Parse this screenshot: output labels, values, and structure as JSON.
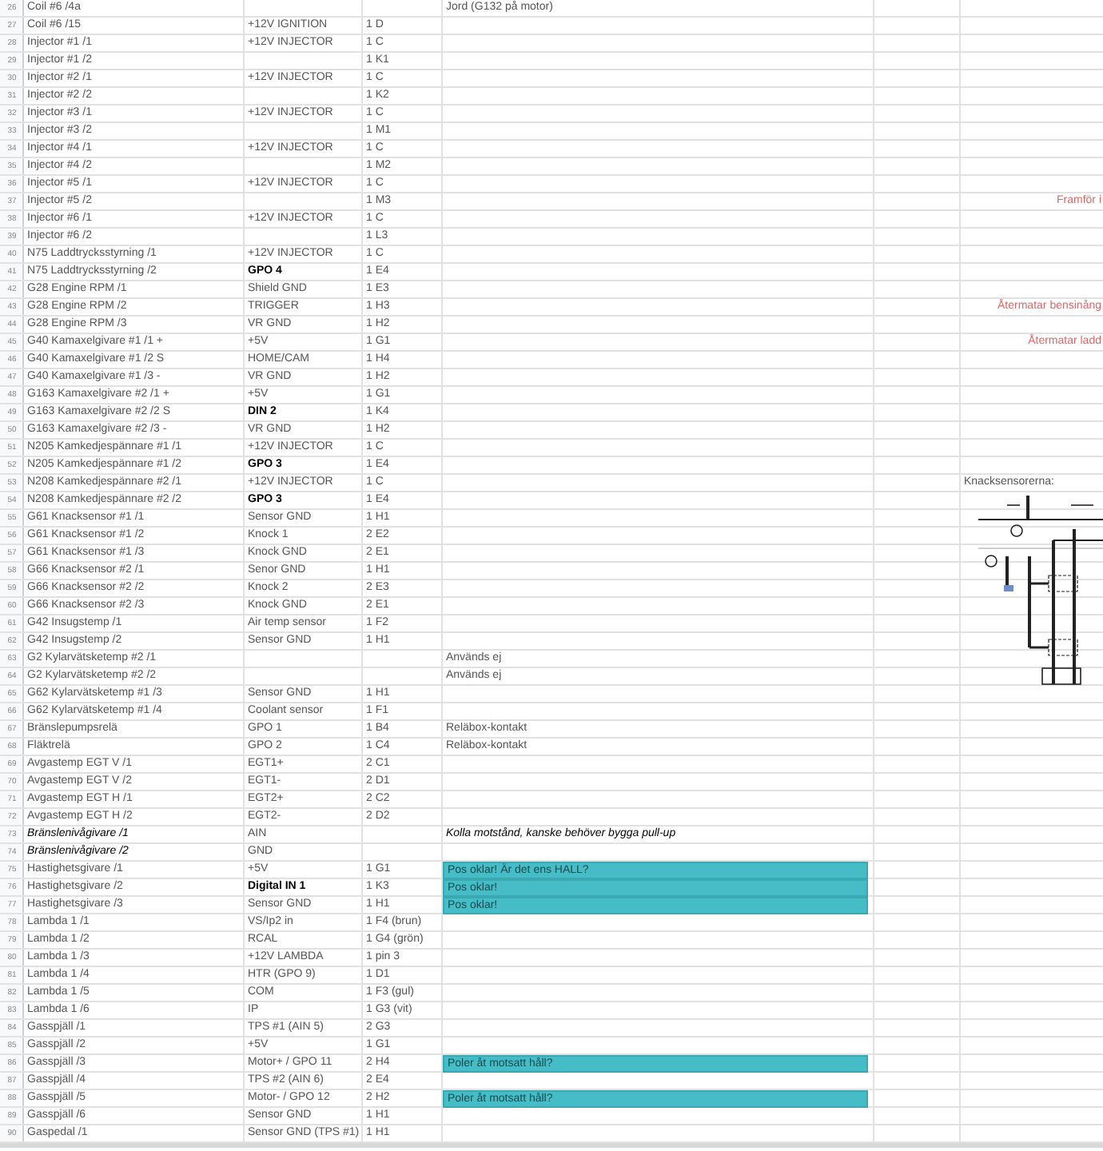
{
  "sheet": {
    "rows": [
      {
        "row": "26",
        "a": "Coil #6 /4a",
        "d": "Jord (G132 på motor)"
      },
      {
        "row": "27",
        "a": "Coil #6 /15",
        "b": "+12V IGNITION",
        "c": "1 D"
      },
      {
        "row": "28",
        "a": "Injector #1 /1",
        "b": "+12V INJECTOR",
        "c": "1 C"
      },
      {
        "row": "29",
        "a": "Injector #1 /2",
        "c": "1 K1"
      },
      {
        "row": "30",
        "a": "Injector #2 /1",
        "b": "+12V INJECTOR",
        "c": "1 C"
      },
      {
        "row": "31",
        "a": "Injector #2 /2",
        "c": "1 K2"
      },
      {
        "row": "32",
        "a": "Injector #3 /1",
        "b": "+12V INJECTOR",
        "c": "1 C"
      },
      {
        "row": "33",
        "a": "Injector #3 /2",
        "c": "1 M1"
      },
      {
        "row": "34",
        "a": "Injector #4 /1",
        "b": "+12V INJECTOR",
        "c": "1 C"
      },
      {
        "row": "35",
        "a": "Injector #4 /2",
        "c": "1 M2"
      },
      {
        "row": "36",
        "a": "Injector #5 /1",
        "b": "+12V INJECTOR",
        "c": "1 C"
      },
      {
        "row": "37",
        "a": "Injector #5 /2",
        "c": "1 M3",
        "f": "Framför i"
      },
      {
        "row": "38",
        "a": "Injector #6 /1",
        "b": "+12V INJECTOR",
        "c": "1 C"
      },
      {
        "row": "39",
        "a": "Injector #6 /2",
        "c": "1 L3"
      },
      {
        "row": "40",
        "a": "N75 Laddtrycksstyrning /1",
        "b": "+12V INJECTOR",
        "c": "1 C"
      },
      {
        "row": "41",
        "a": "N75 Laddtrycksstyrning /2",
        "b": "GPO 4",
        "b_bold": true,
        "c": "1 E4"
      },
      {
        "row": "42",
        "a": "G28 Engine RPM /1",
        "b": "Shield GND",
        "c": "1 E3"
      },
      {
        "row": "43",
        "a": "G28 Engine RPM /2",
        "b": "TRIGGER",
        "c": "1 H3",
        "f": "Återmatar bensinång"
      },
      {
        "row": "44",
        "a": "G28 Engine RPM /3",
        "b": "VR GND",
        "c": "1 H2"
      },
      {
        "row": "45",
        "a": "G40 Kamaxelgivare #1 /1 +",
        "b": "+5V",
        "c": "1 G1",
        "f": "Återmatar ladd"
      },
      {
        "row": "46",
        "a": "G40 Kamaxelgivare #1 /2 S",
        "b": "HOME/CAM",
        "c": "1 H4"
      },
      {
        "row": "47",
        "a": "G40 Kamaxelgivare #1 /3 -",
        "b": "VR GND",
        "c": "1 H2"
      },
      {
        "row": "48",
        "a": "G163 Kamaxelgivare #2 /1 +",
        "b": "+5V",
        "c": "1 G1"
      },
      {
        "row": "49",
        "a": "G163 Kamaxelgivare #2 /2 S",
        "b": "DIN 2",
        "b_bold": true,
        "c": "1 K4"
      },
      {
        "row": "50",
        "a": "G163 Kamaxelgivare #2 /3 -",
        "b": "VR GND",
        "c": "1 H2"
      },
      {
        "row": "51",
        "a": "N205 Kamkedjespännare #1 /1",
        "b": "+12V INJECTOR",
        "c": "1 C"
      },
      {
        "row": "52",
        "a": "N205 Kamkedjespännare #1 /2",
        "b": "GPO 3",
        "b_bold": true,
        "c": "1 E4"
      },
      {
        "row": "53",
        "a": "N208 Kamkedjespännare #2 /1",
        "b": "+12V INJECTOR",
        "c": "1 C",
        "f_label": "Knacksensorerna:"
      },
      {
        "row": "54",
        "a": "N208 Kamkedjespännare #2 /2",
        "b": "GPO 3",
        "b_bold": true,
        "c": "1 E4"
      },
      {
        "row": "55",
        "a": "G61 Knacksensor #1 /1",
        "b": "Sensor GND",
        "c": "1 H1"
      },
      {
        "row": "56",
        "a": "G61 Knacksensor #1 /2",
        "b": "Knock 1",
        "c": "2 E2"
      },
      {
        "row": "57",
        "a": "G61 Knacksensor #1 /3",
        "b": "Knock GND",
        "c": "2 E1"
      },
      {
        "row": "58",
        "a": "G66 Knacksensor #2 /1",
        "b": "Senor GND",
        "c": "1 H1"
      },
      {
        "row": "59",
        "a": "G66 Knacksensor #2 /2",
        "b": "Knock 2",
        "c": "2 E3"
      },
      {
        "row": "60",
        "a": "G66 Knacksensor #2 /3",
        "b": "Knock GND",
        "c": "2 E1"
      },
      {
        "row": "61",
        "a": "G42 Insugstemp /1",
        "b": "Air temp sensor",
        "c": "1 F2"
      },
      {
        "row": "62",
        "a": "G42 Insugstemp /2",
        "b": "Sensor GND",
        "c": "1 H1"
      },
      {
        "row": "63",
        "a": "G2 Kylarvätsketemp #2 /1",
        "d": "Används ej"
      },
      {
        "row": "64",
        "a": "G2 Kylarvätsketemp #2 /2",
        "d": "Används ej"
      },
      {
        "row": "65",
        "a": "G62 Kylarvätsketemp #1 /3",
        "b": "Sensor GND",
        "c": "1 H1"
      },
      {
        "row": "66",
        "a": "G62 Kylarvätsketemp #1 /4",
        "b": "Coolant sensor",
        "c": "1 F1"
      },
      {
        "row": "67",
        "a": "Bränslepumpsrelä",
        "b": "GPO 1",
        "c": "1 B4",
        "d": "Reläbox-kontakt"
      },
      {
        "row": "68",
        "a": "Fläktrelä",
        "b": "GPO 2",
        "c": "1 C4",
        "d": "Reläbox-kontakt"
      },
      {
        "row": "69",
        "a": "Avgastemp EGT V /1",
        "b": "EGT1+",
        "c": "2 C1"
      },
      {
        "row": "70",
        "a": "Avgastemp EGT V /2",
        "b": "EGT1-",
        "c": "2 D1"
      },
      {
        "row": "71",
        "a": "Avgastemp EGT H /1",
        "b": "EGT2+",
        "c": "2 C2"
      },
      {
        "row": "72",
        "a": "Avgastemp EGT H /2",
        "b": "EGT2-",
        "c": "2 D2"
      },
      {
        "row": "73",
        "a": "Bränslenivågivare /1",
        "italic": true,
        "b": "AIN",
        "d": "Kolla motstånd, kanske behöver bygga pull-up"
      },
      {
        "row": "74",
        "a": "Bränslenivågivare /2",
        "italic": true,
        "b": "GND"
      },
      {
        "row": "75",
        "a": "Hastighetsgivare /1",
        "b": "+5V",
        "c": "1 G1",
        "d": "Pos oklar! Är det ens HALL?",
        "highlight": true
      },
      {
        "row": "76",
        "a": "Hastighetsgivare /2",
        "b": "Digital IN 1",
        "b_bold": true,
        "c": "1 K3",
        "d": "Pos oklar!",
        "highlight": true
      },
      {
        "row": "77",
        "a": "Hastighetsgivare /3",
        "b": "Sensor GND",
        "c": "1 H1",
        "d": "Pos oklar!",
        "highlight": true
      },
      {
        "row": "78",
        "a": "Lambda 1 /1",
        "b": "VS/Ip2 in",
        "c": "1 F4 (brun)"
      },
      {
        "row": "79",
        "a": "Lambda 1 /2",
        "b": "RCAL",
        "c": "1 G4 (grön)"
      },
      {
        "row": "80",
        "a": "Lambda 1 /3",
        "b": "+12V LAMBDA",
        "c": "1 pin 3"
      },
      {
        "row": "81",
        "a": "Lambda 1 /4",
        "b": "HTR (GPO 9)",
        "c": "1 D1"
      },
      {
        "row": "82",
        "a": "Lambda 1 /5",
        "b": "COM",
        "c": "1 F3 (gul)"
      },
      {
        "row": "83",
        "a": "Lambda 1 /6",
        "b": "IP",
        "c": "1 G3 (vit)"
      },
      {
        "row": "84",
        "a": "Gasspjäll /1",
        "b": "TPS #1 (AIN 5)",
        "c": "2 G3"
      },
      {
        "row": "85",
        "a": "Gasspjäll /2",
        "b": "+5V",
        "c": "1 G1"
      },
      {
        "row": "86",
        "a": "Gasspjäll /3",
        "b": "Motor+ / GPO 11",
        "c": "2 H4",
        "d": "Poler åt motsatt håll?",
        "highlight": true
      },
      {
        "row": "87",
        "a": "Gasspjäll /4",
        "b": "TPS #2 (AIN 6)",
        "c": "2 E4"
      },
      {
        "row": "88",
        "a": "Gasspjäll /5",
        "b": "Motor- / GPO 12",
        "c": "2 H2",
        "d": "Poler åt motsatt håll?",
        "highlight": true
      },
      {
        "row": "89",
        "a": "Gasspjäll /6",
        "b": "Sensor GND",
        "c": "1 H1"
      },
      {
        "row": "90",
        "a": "Gaspedal /1",
        "b": "Sensor GND (TPS #1)",
        "c": "1 H1"
      }
    ]
  }
}
